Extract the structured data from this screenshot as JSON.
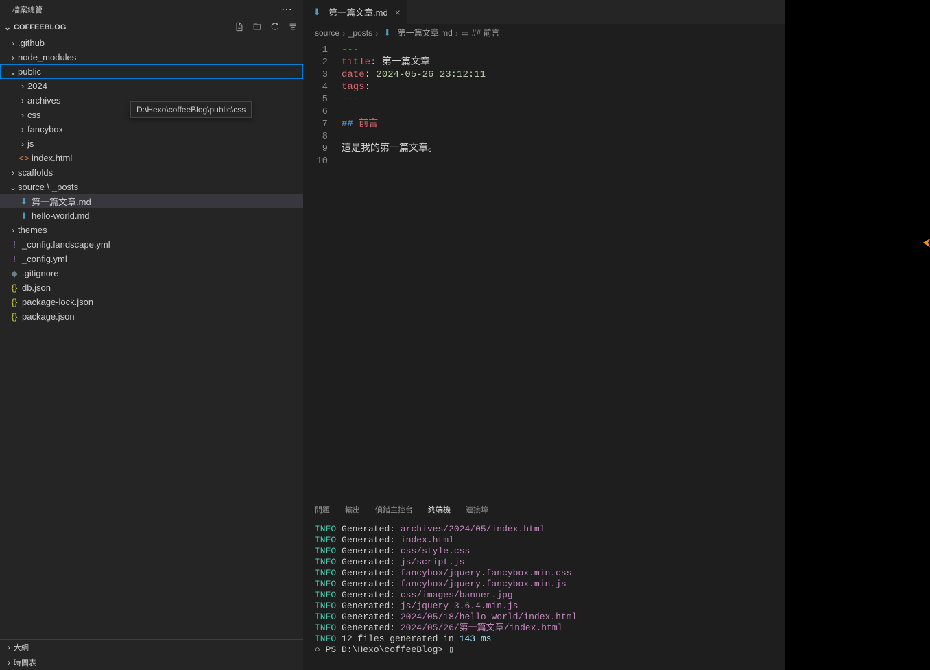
{
  "sidebar": {
    "title": "檔案總管",
    "project": "COFFEEBLOG",
    "tree": [
      {
        "type": "folder",
        "label": ".github",
        "indent": 1,
        "open": false
      },
      {
        "type": "folder",
        "label": "node_modules",
        "indent": 1,
        "open": false
      },
      {
        "type": "folder",
        "label": "public",
        "indent": 1,
        "open": true,
        "focused": true
      },
      {
        "type": "folder",
        "label": "2024",
        "indent": 2,
        "open": false
      },
      {
        "type": "folder",
        "label": "archives",
        "indent": 2,
        "open": false
      },
      {
        "type": "folder",
        "label": "css",
        "indent": 2,
        "open": false
      },
      {
        "type": "folder",
        "label": "fancybox",
        "indent": 2,
        "open": false
      },
      {
        "type": "folder",
        "label": "js",
        "indent": 2,
        "open": false
      },
      {
        "type": "file",
        "label": "index.html",
        "indent": 2,
        "icon": "html"
      },
      {
        "type": "folder",
        "label": "scaffolds",
        "indent": 1,
        "open": false
      },
      {
        "type": "folder",
        "label": "source \\ _posts",
        "indent": 1,
        "open": true
      },
      {
        "type": "file",
        "label": "第一篇文章.md",
        "indent": 2,
        "icon": "md",
        "active": true
      },
      {
        "type": "file",
        "label": "hello-world.md",
        "indent": 2,
        "icon": "md"
      },
      {
        "type": "folder",
        "label": "themes",
        "indent": 1,
        "open": false
      },
      {
        "type": "file",
        "label": "_config.landscape.yml",
        "indent": 1,
        "icon": "yml"
      },
      {
        "type": "file",
        "label": "_config.yml",
        "indent": 1,
        "icon": "yml"
      },
      {
        "type": "file",
        "label": ".gitignore",
        "indent": 1,
        "icon": "gitignore"
      },
      {
        "type": "file",
        "label": "db.json",
        "indent": 1,
        "icon": "json"
      },
      {
        "type": "file",
        "label": "package-lock.json",
        "indent": 1,
        "icon": "json"
      },
      {
        "type": "file",
        "label": "package.json",
        "indent": 1,
        "icon": "json"
      }
    ],
    "tooltip": "D:\\Hexo\\coffeeBlog\\public\\css",
    "footer": {
      "outline": "大綱",
      "timeline": "時間表"
    }
  },
  "tabs": [
    {
      "label": "第一篇文章.md",
      "icon": "md"
    }
  ],
  "breadcrumbs": {
    "parts": [
      "source",
      "_posts",
      "第一篇文章.md",
      "## 前言"
    ]
  },
  "editor": {
    "lines": [
      {
        "n": "1",
        "tokens": [
          {
            "c": "gray",
            "t": "---"
          }
        ]
      },
      {
        "n": "2",
        "tokens": [
          {
            "c": "red",
            "t": "title"
          },
          {
            "c": "text",
            "t": ": 第一篇文章"
          }
        ]
      },
      {
        "n": "3",
        "tokens": [
          {
            "c": "red",
            "t": "date"
          },
          {
            "c": "text",
            "t": ": "
          },
          {
            "c": "date",
            "t": "2024-05-26 23:12:11"
          }
        ]
      },
      {
        "n": "4",
        "tokens": [
          {
            "c": "red",
            "t": "tags"
          },
          {
            "c": "text",
            "t": ":"
          }
        ]
      },
      {
        "n": "5",
        "tokens": [
          {
            "c": "gray",
            "t": "---"
          }
        ]
      },
      {
        "n": "6",
        "tokens": []
      },
      {
        "n": "7",
        "tokens": [
          {
            "c": "blue",
            "t": "## "
          },
          {
            "c": "red",
            "t": "前言"
          }
        ]
      },
      {
        "n": "8",
        "tokens": []
      },
      {
        "n": "9",
        "tokens": [
          {
            "c": "text",
            "t": "這是我的第一篇文章。"
          }
        ]
      },
      {
        "n": "10",
        "tokens": []
      }
    ]
  },
  "panel": {
    "tabs": {
      "problems": "問題",
      "output": "輸出",
      "debug": "偵錯主控台",
      "terminal": "終端機",
      "ports": "連接埠"
    },
    "lines": [
      {
        "info": "INFO",
        "text": "Generated:",
        "path": "archives/2024/05/index.html"
      },
      {
        "info": "INFO",
        "text": "Generated:",
        "path": "index.html"
      },
      {
        "info": "INFO",
        "text": "Generated:",
        "path": "css/style.css"
      },
      {
        "info": "INFO",
        "text": "Generated:",
        "path": "js/script.js"
      },
      {
        "info": "INFO",
        "text": "Generated:",
        "path": "fancybox/jquery.fancybox.min.css"
      },
      {
        "info": "INFO",
        "text": "Generated:",
        "path": "fancybox/jquery.fancybox.min.js"
      },
      {
        "info": "INFO",
        "text": "Generated:",
        "path": "css/images/banner.jpg"
      },
      {
        "info": "INFO",
        "text": "Generated:",
        "path": "js/jquery-3.6.4.min.js"
      },
      {
        "info": "INFO",
        "text": "Generated:",
        "path": "2024/05/18/hello-world/index.html"
      },
      {
        "info": "INFO",
        "text": "Generated:",
        "path": "2024/05/26/第一篇文章/index.html"
      }
    ],
    "summary": {
      "info": "INFO",
      "pre": "12 files generated in ",
      "num": "143 ms"
    },
    "prompt": "PS D:\\Hexo\\coffeeBlog> "
  }
}
